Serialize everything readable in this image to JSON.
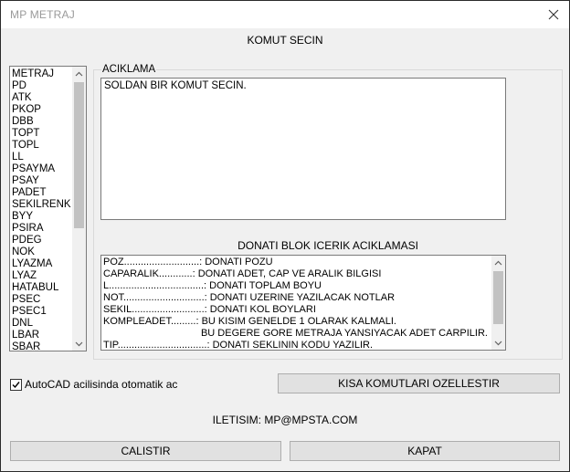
{
  "window": {
    "title": "MP METRAJ",
    "close_glyph": "✕"
  },
  "heading": "KOMUT SECIN",
  "command_list": {
    "items": [
      "METRAJ",
      "PD",
      "ATK",
      "PKOP",
      "DBB",
      "TOPT",
      "TOPL",
      "LL",
      "PSAYMA",
      "PSAY",
      "PADET",
      "SEKILRENK",
      "BYY",
      "PSIRA",
      "PDEG",
      "NOK",
      "LYAZMA",
      "LYAZ",
      "HATABUL",
      "PSEC",
      "PSEC1",
      "DNL",
      "LBAR",
      "SBAR"
    ],
    "scroll_fraction": 0.0
  },
  "description": {
    "label": "ACIKLAMA",
    "text": "SOLDAN BIR KOMUT SECIN."
  },
  "block_info": {
    "heading": "DONATI BLOK ICERIK ACIKLAMASI",
    "lines": [
      "POZ...........................: DONATI POZU",
      "CAPARALIK............: DONATI ADET, CAP VE ARALIK BILGISI",
      "L..................................: DONATI TOPLAM BOYU",
      "NOT.............................: DONATI UZERINE YAZILACAK NOTLAR",
      "SEKIL..........................: DONATI KOL BOYLARI",
      "KOMPLEADET.........: BU KISIM GENELDE 1 OLARAK KALMALI.",
      "                                   BU DEGERE GORE METRAJA YANSIYACAK ADET CARPILIR.",
      "TIP................................: DONATI SEKLININ KODU YAZILIR."
    ]
  },
  "autocad_checkbox": {
    "label": "AutoCAD acilisinda otomatik ac",
    "checked": true
  },
  "buttons": {
    "customize": "KISA KOMUTLARI OZELLESTIR",
    "run": "CALISTIR",
    "close": "KAPAT"
  },
  "contact": "ILETISIM: MP@MPSTA.COM"
}
